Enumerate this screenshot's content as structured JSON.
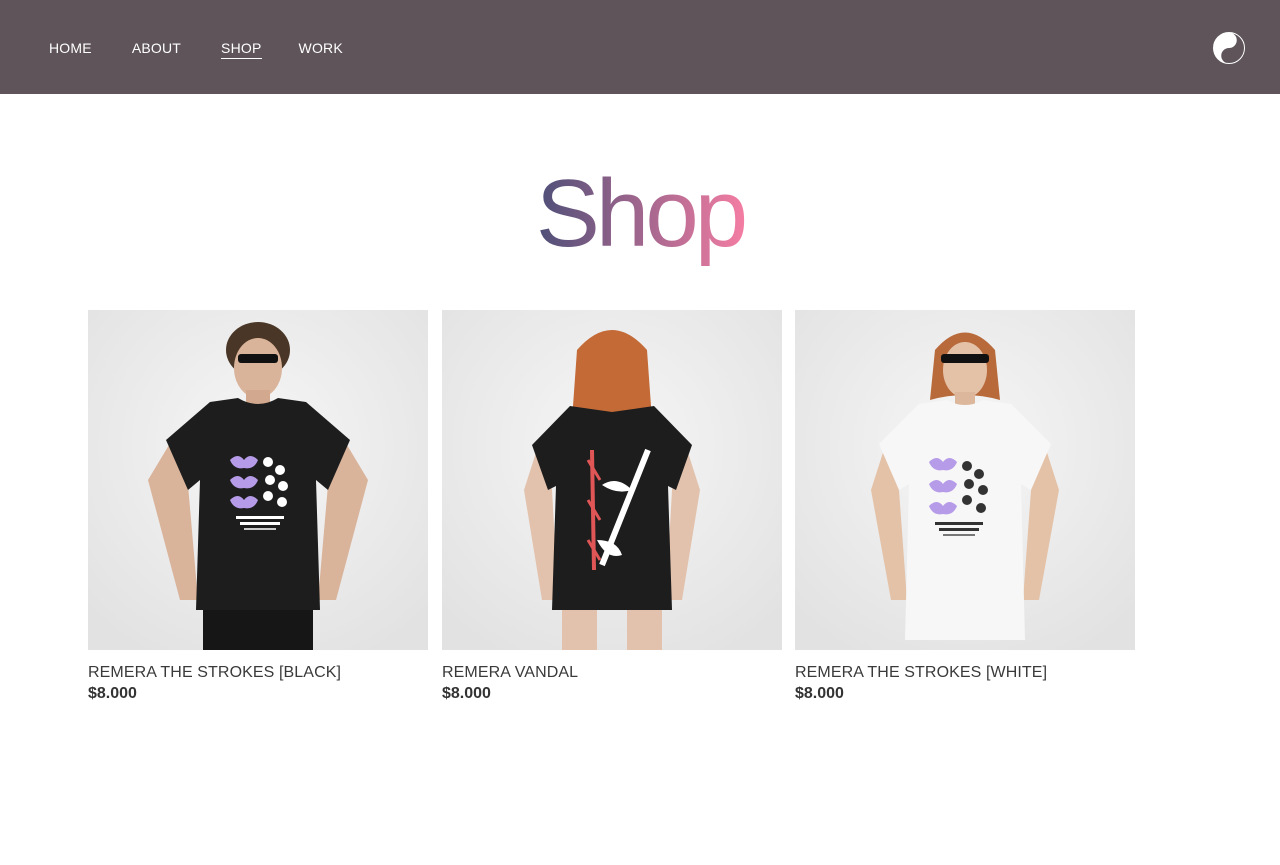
{
  "nav": {
    "items": [
      {
        "label": "HOME"
      },
      {
        "label": "ABOUT"
      },
      {
        "label": "SHOP",
        "active": true
      },
      {
        "label": "WORK"
      }
    ]
  },
  "header": {
    "logo_icon": "yin-yang-icon",
    "background": "#5e5459"
  },
  "main": {
    "title": "Shop",
    "title_gradient": [
      "#4d4f78",
      "#f47da3"
    ]
  },
  "products": [
    {
      "name": "REMERA THE STROKES [BLACK]",
      "price": "$8.000",
      "shirt_color": "#1d1d1d"
    },
    {
      "name": "REMERA VANDAL",
      "price": "$8.000",
      "shirt_color": "#1d1d1d"
    },
    {
      "name": "REMERA THE STROKES [WHITE]",
      "price": "$8.000",
      "shirt_color": "#f7f7f7"
    }
  ]
}
